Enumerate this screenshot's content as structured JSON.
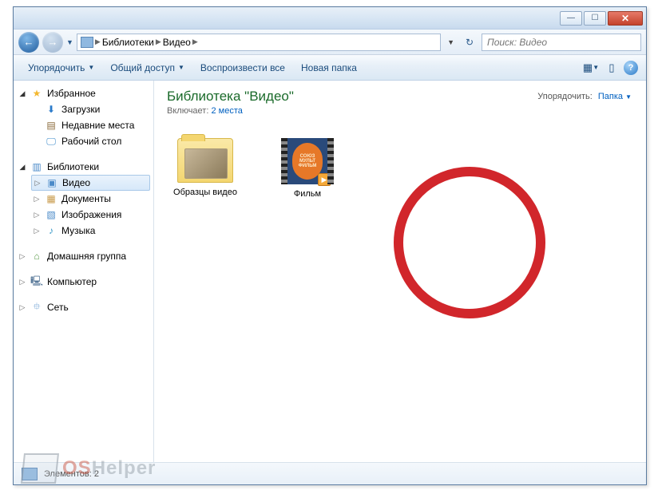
{
  "breadcrumb": {
    "root": "Библиотеки",
    "sub": "Видео"
  },
  "search": {
    "placeholder": "Поиск: Видео"
  },
  "toolbar": {
    "organize": "Упорядочить",
    "share": "Общий доступ",
    "play_all": "Воспроизвести все",
    "new_folder": "Новая папка"
  },
  "sidebar": {
    "favorites": "Избранное",
    "downloads": "Загрузки",
    "recent": "Недавние места",
    "desktop": "Рабочий стол",
    "libraries": "Библиотеки",
    "video": "Видео",
    "documents": "Документы",
    "images": "Изображения",
    "music": "Музыка",
    "homegroup": "Домашняя группа",
    "computer": "Компьютер",
    "network": "Сеть"
  },
  "main": {
    "title": "Библиотека \"Видео\"",
    "includes_label": "Включает:",
    "includes_link": "2 места",
    "arrange_label": "Упорядочить:",
    "arrange_value": "Папка"
  },
  "items": {
    "samples": "Образцы видео",
    "film": "Фильм",
    "film_badge": "СОЮЗ\nМУЛЬТ\nФИЛЬМ"
  },
  "status": {
    "count_label": "Элементов: 2"
  },
  "watermark": {
    "os": "OS",
    "helper": "Helper"
  }
}
